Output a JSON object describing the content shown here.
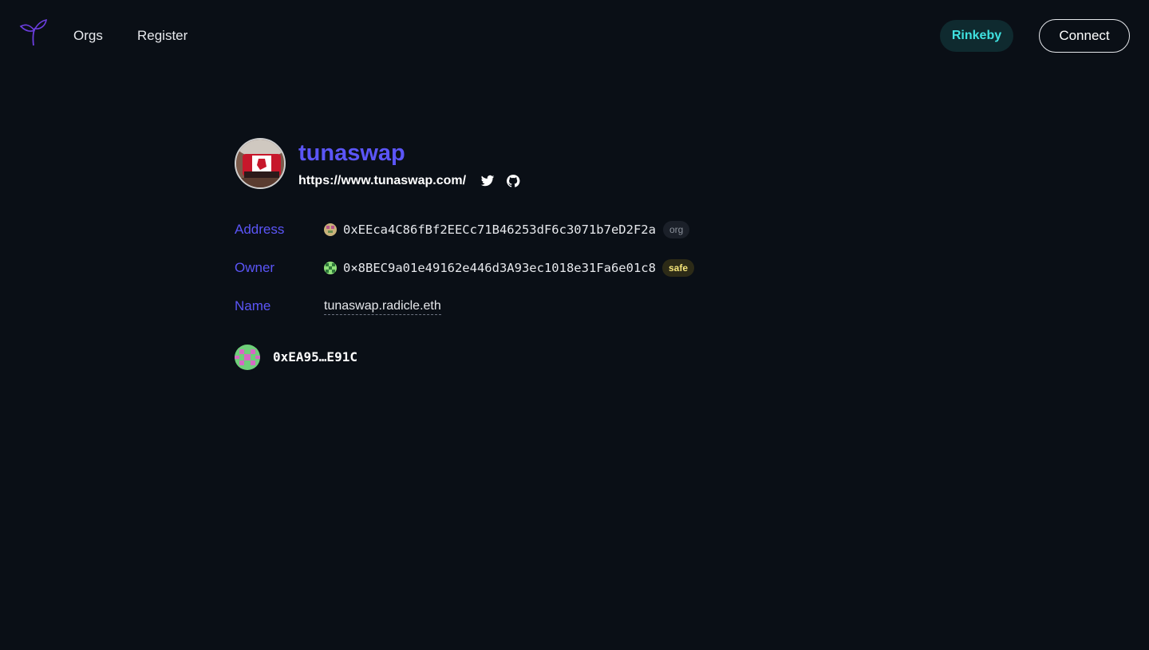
{
  "nav": {
    "links": [
      "Orgs",
      "Register"
    ],
    "network": "Rinkeby",
    "connect_label": "Connect"
  },
  "org": {
    "name": "tunaswap",
    "url": "https://www.tunaswap.com/",
    "fields": {
      "address_label": "Address",
      "address": "0xEEca4C86fBf2EECc71B46253dF6c3071b7eD2F2a",
      "address_badge": "org",
      "owner_label": "Owner",
      "owner": "0×8BEC9a01e49162e446d3A93ec1018e31Fa6e01c8",
      "owner_badge": "safe",
      "name_label": "Name",
      "name": "tunaswap.radicle.eth"
    },
    "members": [
      "0xEA95…E91C"
    ]
  },
  "colors": {
    "background": "#0a0f16",
    "accent": "#5b55f7",
    "network": "#3fe1e0",
    "safe_badge": "#f5e57a"
  },
  "icons": [
    "radicle-logo-icon",
    "twitter-icon",
    "github-icon"
  ]
}
